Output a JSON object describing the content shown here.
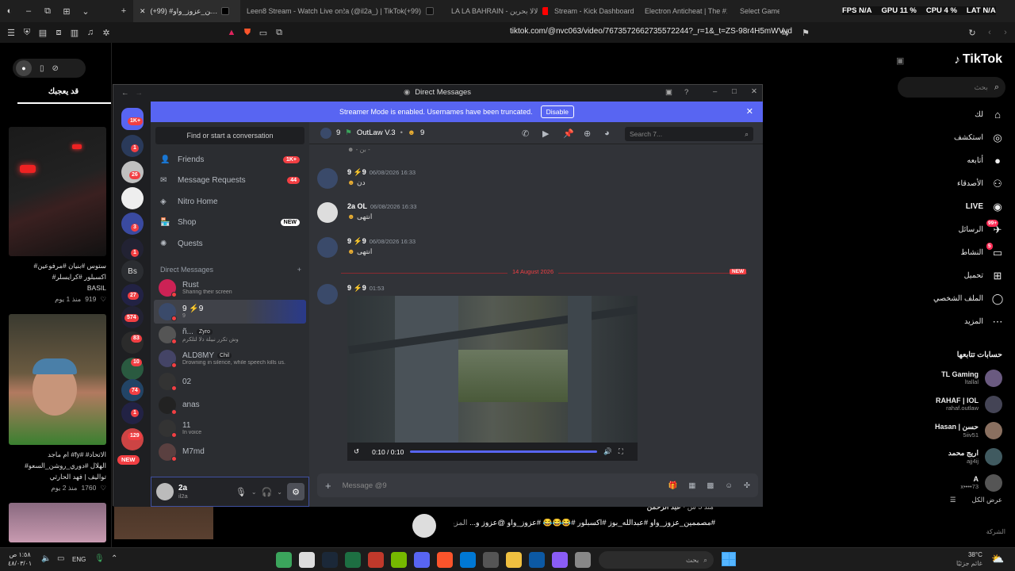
{
  "browser": {
    "tabs": [
      {
        "label": "(+99) #مصممين_عزوز_واو",
        "active": true,
        "color": "#000000"
      },
      {
        "label": "Leen8 Stream - Watch Live on",
        "color": "#53fc18"
      },
      {
        "label": "2a (@il2a_) | TikTok(+99)",
        "color": "#111111"
      },
      {
        "label": "LA LA BAHRAIN - لالا بحرين",
        "color": "#ff0000"
      },
      {
        "label": "Stream - Kick Dashboard",
        "color": "#53fc18"
      },
      {
        "label": "Electron Anticheat | The #1 Fi",
        "color": "#2a2a2a"
      },
      {
        "label": "Select Game - Opti",
        "color": "#444444"
      }
    ],
    "overlay": {
      "fps": "FPS N/A",
      "gpu": "GPU 11 %",
      "cpu": "CPU 4 %",
      "lat": "LAT N/A"
    },
    "url": "tiktok.com/@nvc063/video/7673572662735572244?_r=1&_t=ZS-98r4H5mWVvd"
  },
  "tiktok_left": {
    "tab_label": "قد يعجبك",
    "card1_caption": "#ستوس #بنيان #مرفوعين",
    "card1_caption2": "#اكسبلور #كرايسلر",
    "card1_user": "BASIL",
    "card1_likes": "919",
    "card1_age": "منذ 1 يوم",
    "card2_caption": "ام ماجد #fy# #الاتحاد",
    "card2_caption2": "#الهلال #دوري_روشن_السعو",
    "card2_caption3": "تواليف | فهد الحارثي",
    "card2_likes": "1760",
    "card2_age": "منذ 2 يوم"
  },
  "tiktok_right": {
    "logo": "TikTok",
    "search_placeholder": "بحث",
    "nav": [
      {
        "label": "لك",
        "icon": "home-icon"
      },
      {
        "label": "استكشف",
        "icon": "compass-icon"
      },
      {
        "label": "أتابعه",
        "icon": "following-icon"
      },
      {
        "label": "الأصدقاء",
        "icon": "friends-icon"
      },
      {
        "label": "LIVE",
        "icon": "live-icon"
      },
      {
        "label": "الرسائل",
        "icon": "messages-icon",
        "badge": "99+"
      },
      {
        "label": "النشاط",
        "icon": "activity-icon",
        "badge": "5"
      },
      {
        "label": "تحميل",
        "icon": "upload-icon"
      },
      {
        "label": "الملف الشخصي",
        "icon": "profile-icon"
      },
      {
        "label": "المزيد",
        "icon": "more-icon"
      }
    ],
    "following_title": "حسابات تتابعها",
    "following": [
      {
        "name": "TL Gaming",
        "handle": "ltallal"
      },
      {
        "name": "RAHAF | IOL",
        "handle": "rahaf.outlaw"
      },
      {
        "name": "Hasan | حسن",
        "handle": "5iiv51"
      },
      {
        "name": "اريج محمد",
        "handle": "ajj4ij"
      },
      {
        "name": "A",
        "handle": "x••••73"
      }
    ],
    "see_all": "عرض الكل",
    "company": "الشركة"
  },
  "tiktok_comment": {
    "author": "عبد الرحمن",
    "age": "منذ 5 س",
    "text": "#مصممين_عزوز_واو #عبدالله_بوز #اكسبلور #😂😂😂 #عزوز_واو @عزوز و...",
    "more": "المزيد"
  },
  "discord": {
    "title": "Direct Messages",
    "streamer_text": "Streamer Mode is enabled. Usernames have been truncated.",
    "disable_label": "Disable",
    "search_conv": "Find or start a conversation",
    "nav": [
      {
        "label": "Friends",
        "badge": "1K+",
        "icon": "friends-icon"
      },
      {
        "label": "Message Requests",
        "badge": "44",
        "icon": "mail-icon"
      },
      {
        "label": "Nitro Home",
        "badge": "",
        "icon": "nitro-icon"
      },
      {
        "label": "Shop",
        "badge": "NEW",
        "icon": "shop-icon"
      },
      {
        "label": "Quests",
        "badge": "",
        "icon": "quests-icon"
      }
    ],
    "dm_header": "Direct Messages",
    "dms": [
      {
        "name": "Rust",
        "sub": "Sharing their screen",
        "color": "#c25"
      },
      {
        "name": "9 ⚡9",
        "sub": "9",
        "color": "#3a4a6a",
        "active": true
      },
      {
        "name": "ñ...",
        "tag": "Zyro",
        "sub": "وش تكرر نبيلة ذلا لتلكرم",
        "color": "#555"
      },
      {
        "name": "ALD8MY",
        "tag": "Chil",
        "sub": "Drowning in silence, while speech kills us.",
        "color": "#446"
      },
      {
        "name": "02",
        "sub": "",
        "color": "#333"
      },
      {
        "name": "anas",
        "sub": "",
        "color": "#222"
      },
      {
        "name": "11",
        "sub": "In voice",
        "color": "#333"
      },
      {
        "name": "M7md",
        "sub": "",
        "color": "#5a4040"
      }
    ],
    "user": {
      "name": "2a",
      "sub": "il2a"
    },
    "guild_badges": [
      "1K+",
      "1",
      "26",
      "3",
      "1",
      "27",
      "574",
      "83",
      "10",
      "74",
      "1",
      "129"
    ],
    "guild_new": "NEW",
    "guild_text": "Bs",
    "chat_header": {
      "name": "9",
      "server": "OutLaw V.3",
      "extra": "9"
    },
    "chat_search_placeholder": "Search 7...",
    "messages": [
      {
        "author": "9 ⚡9",
        "time": "06/08/2026 16:33",
        "text": "دن"
      },
      {
        "author": "2a OL",
        "time": "06/08/2026 16:33",
        "text": "انتهى"
      },
      {
        "author": "9 ⚡9",
        "time": "06/08/2026 16:33",
        "text": "انتهى"
      }
    ],
    "date_divider": "14 August 2026",
    "new_label": "NEW",
    "video_msg": {
      "author": "9 ⚡9",
      "time": "01:53",
      "video_time": "0:10 / 0:10"
    },
    "input_placeholder": "Message @9"
  },
  "taskbar": {
    "clock_time": "١:٥٨ ص",
    "clock_date": "٤٨/٠٣/٠١",
    "lang": "ENG",
    "search": "بحث",
    "weather_temp": "38°C",
    "weather_text": "غائم جزئيًا"
  }
}
